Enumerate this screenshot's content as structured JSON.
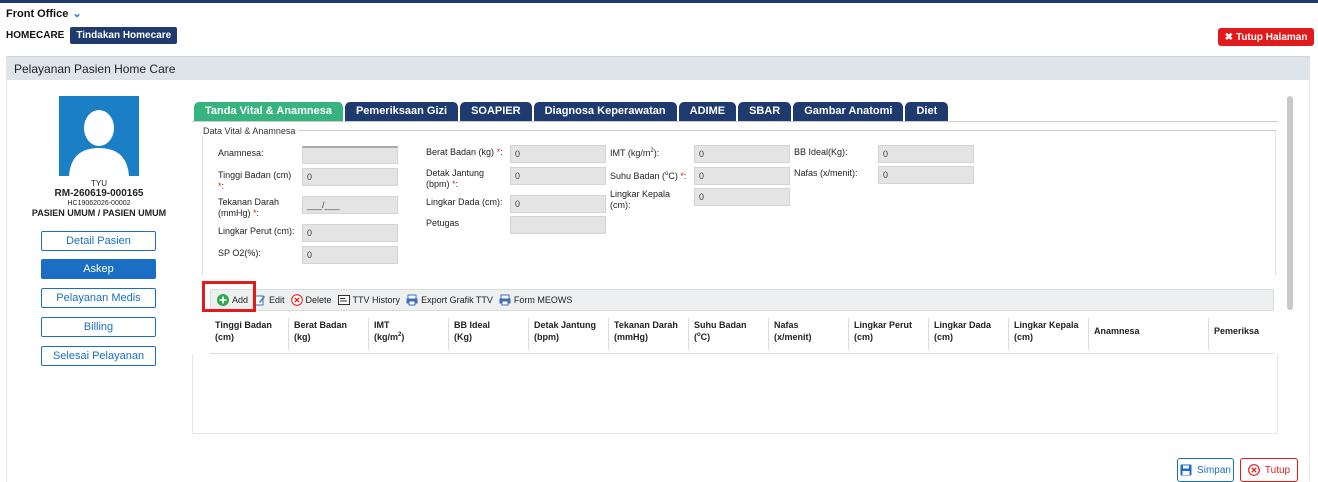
{
  "header": {
    "module": "Front Office",
    "breadcrumb_root": "HOMECARE",
    "breadcrumb_active": "Tindakan Homecare",
    "close_page_label": "Tutup Halaman"
  },
  "panel": {
    "title": "Pelayanan Pasien Home Care"
  },
  "patient": {
    "name": "TYU",
    "rm": "RM-260619-000165",
    "hc": "HC19062026-00002",
    "type": "PASIEN UMUM / PASIEN UMUM"
  },
  "sidebar": {
    "items": [
      {
        "label": "Detail Pasien"
      },
      {
        "label": "Askep"
      },
      {
        "label": "Pelayanan Medis"
      },
      {
        "label": "Billing"
      },
      {
        "label": "Selesai Pelayanan"
      }
    ]
  },
  "tabs": [
    {
      "label": "Tanda Vital & Anamnesa"
    },
    {
      "label": "Pemeriksaan Gizi"
    },
    {
      "label": "SOAPIER"
    },
    {
      "label": "Diagnosa Keperawatan"
    },
    {
      "label": "ADIME"
    },
    {
      "label": "SBAR"
    },
    {
      "label": "Gambar Anatomi"
    },
    {
      "label": "Diet"
    }
  ],
  "form": {
    "legend": "Data Vital & Anamnesa",
    "anamnesa_label": "Anamnesa:",
    "anamnesa_value": "",
    "tinggi_label": "Tinggi Badan (cm)",
    "tinggi_value": "0",
    "tekanan_label_1": "Tekanan Darah",
    "tekanan_label_2": "(mmHg)",
    "tekanan_value": "___/___",
    "lingkar_perut_label": "Lingkar Perut (cm):",
    "lingkar_perut_value": "0",
    "spo2_label": "SP O2(%):",
    "spo2_value": "0",
    "berat_label": "Berat Badan (kg)",
    "berat_value": "0",
    "detak_label_1": "Detak Jantung",
    "detak_label_2": "(bpm)",
    "detak_value": "0",
    "lingkar_dada_label": "Lingkar Dada (cm):",
    "lingkar_dada_value": "0",
    "petugas_label": "Petugas",
    "petugas_value": "",
    "imt_label_prefix": "IMT (kg/m",
    "imt_label_sup": "2",
    "imt_label_suffix": "):",
    "imt_value": "0",
    "suhu_label_prefix": "Suhu Badan (",
    "suhu_label_sup": "o",
    "suhu_label_suffix": "C)",
    "suhu_value": "0",
    "lingkar_kepala_label_1": "Lingkar Kepala",
    "lingkar_kepala_label_2": "(cm):",
    "lingkar_kepala_value": "0",
    "bb_ideal_label": "BB Ideal(Kg):",
    "bb_ideal_value": "0",
    "nafas_label": "Nafas (x/menit):",
    "nafas_value": "0",
    "required_mark": "*",
    "required_colon": ":"
  },
  "toolbar": {
    "add": "Add",
    "edit": "Edit",
    "delete": "Delete",
    "ttv_history": "TTV History",
    "export": "Export Grafik TTV",
    "meows": "Form MEOWS"
  },
  "table": {
    "columns": [
      {
        "l1": "Tinggi Badan",
        "l2": "(cm)"
      },
      {
        "l1": "Berat Badan",
        "l2": "(kg)"
      },
      {
        "l1": "IMT",
        "l2": "(kg/m",
        "sup": "2",
        "l3": ")"
      },
      {
        "l1": "BB Ideal",
        "l2": "(Kg)"
      },
      {
        "l1": "Detak Jantung",
        "l2": "(bpm)"
      },
      {
        "l1": "Tekanan Darah",
        "l2": "(mmHg)"
      },
      {
        "l1": "Suhu Badan",
        "l2": "(",
        "sup": "o",
        "l3": "C)"
      },
      {
        "l1": "Nafas",
        "l2": "(x/menit)"
      },
      {
        "l1": "Lingkar Perut",
        "l2": "(cm)"
      },
      {
        "l1": "Lingkar Dada",
        "l2": "(cm)"
      },
      {
        "l1": "Lingkar Kepala",
        "l2": "(cm)"
      },
      {
        "l1": "Anamnesa",
        "l2": ""
      },
      {
        "l1": "Pemeriksa",
        "l2": ""
      }
    ]
  },
  "footer": {
    "save": "Simpan",
    "close": "Tutup"
  },
  "colors": {
    "navy": "#1f3a6e",
    "green": "#36b37e",
    "blue": "#1a6fc4",
    "red": "#e11b1b"
  },
  "icons": {
    "chevron": "chevron-down-icon",
    "close": "close-icon",
    "add": "plus-circle-icon",
    "edit": "edit-icon",
    "delete": "delete-icon",
    "history": "history-icon",
    "export": "print-icon",
    "save": "save-icon"
  }
}
